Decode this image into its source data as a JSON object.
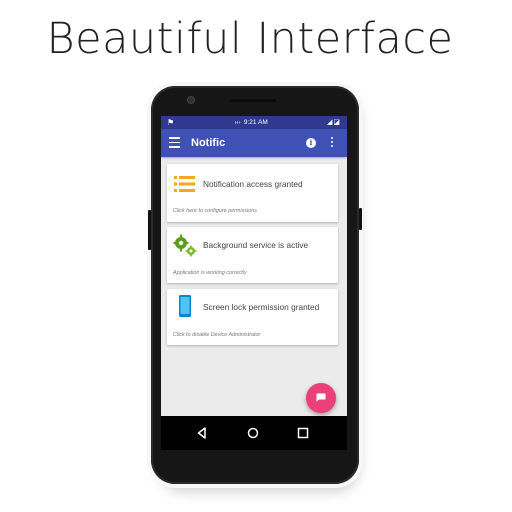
{
  "headline": "Beautiful Interface",
  "status_bar": {
    "network": "H+",
    "time": "9:21 AM",
    "left_icon": "notification-pin-icon",
    "right_icons": [
      "signal-icon",
      "battery-icon"
    ]
  },
  "app_bar": {
    "title": "Notific",
    "menu_icon": "hamburger-menu-icon",
    "info_icon": "info-icon",
    "more_icon": "more-vert-icon"
  },
  "cards": [
    {
      "title": "Notification access granted",
      "subtitle": "Click here to configure permissions",
      "icon": "list-icon",
      "color": "#f5a623"
    },
    {
      "title": "Background service is active",
      "subtitle": "Application is working correctly",
      "icon": "gears-icon",
      "color": "#5a9e1c"
    },
    {
      "title": "Screen lock permission granted",
      "subtitle": "Click to disable Device Administrator",
      "icon": "phone-icon",
      "color": "#29b6f6"
    }
  ],
  "fab": {
    "icon": "message-icon",
    "color": "#ec407a"
  },
  "nav_bar": {
    "icons": [
      "back-icon",
      "home-icon",
      "recents-icon"
    ]
  },
  "colors": {
    "primary": "#3f51b5",
    "status_bar": "#2f3a8f",
    "accent": "#ec407a"
  }
}
